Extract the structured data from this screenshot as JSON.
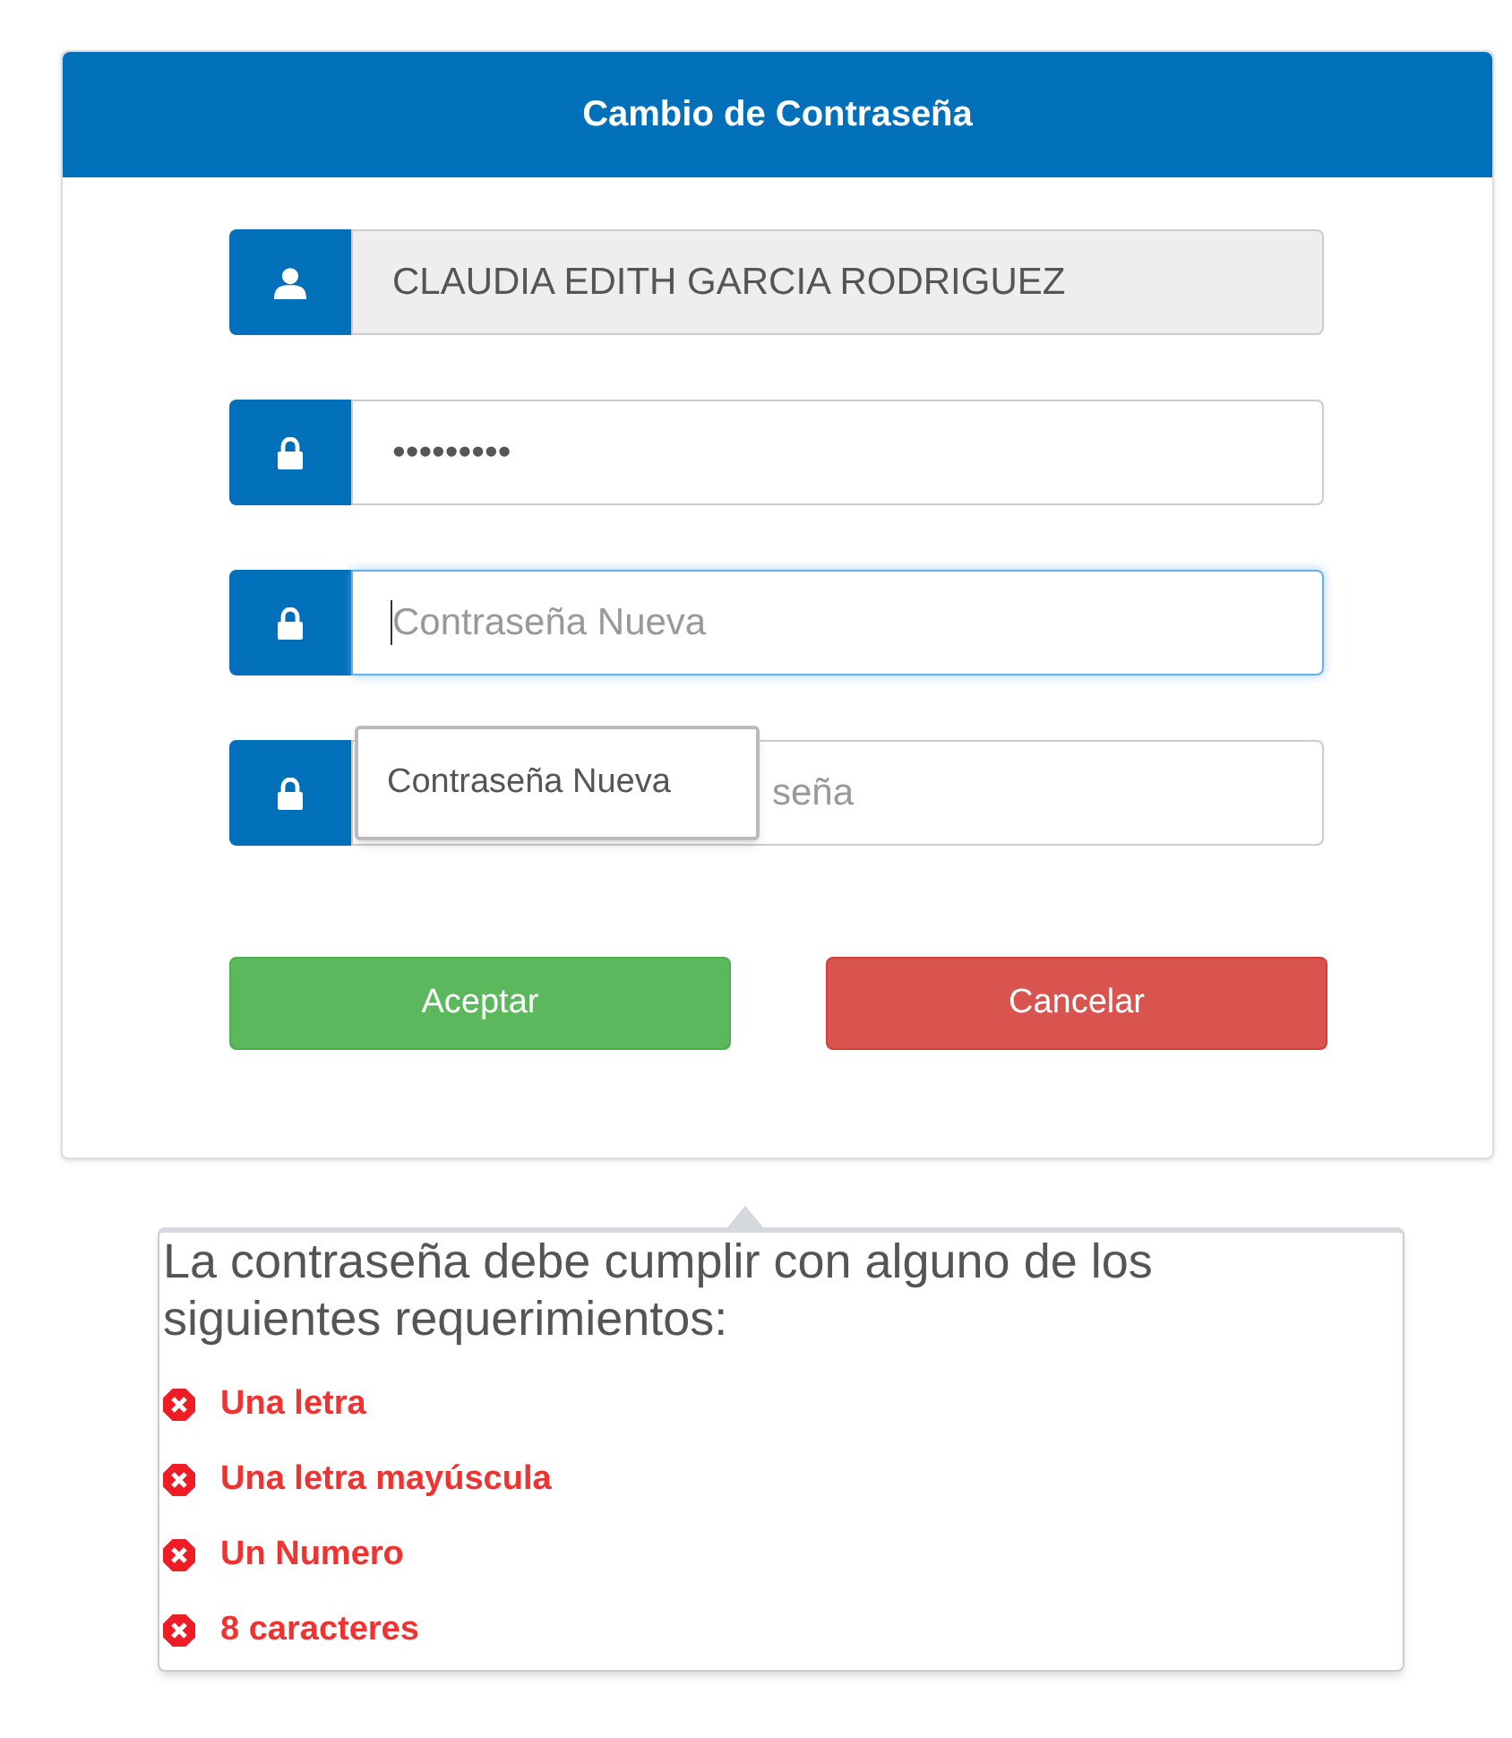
{
  "dialog": {
    "title": "Cambio de Contraseña"
  },
  "fields": [
    {
      "kind": "user",
      "value": "CLAUDIA EDITH GARCIA RODRIGUEZ",
      "disabled": true,
      "focused": false
    },
    {
      "kind": "password",
      "value": "•••••••••",
      "disabled": false,
      "focused": false
    },
    {
      "kind": "password",
      "placeholder": "Contraseña Nueva",
      "disabled": false,
      "focused": true
    },
    {
      "kind": "password",
      "placeholder": "seña",
      "disabled": false,
      "focused": false,
      "suggestion": "Contraseña Nueva"
    }
  ],
  "buttons": [
    {
      "kind": "accept",
      "label": "Aceptar"
    },
    {
      "kind": "cancel",
      "label": "Cancelar"
    }
  ],
  "requirements": {
    "title": "La contraseña debe cumplir con alguno de los siguientes requerimientos:",
    "items": [
      {
        "label": "Una letra",
        "met": false
      },
      {
        "label": "Una letra mayúscula",
        "met": false
      },
      {
        "label": "Un Numero",
        "met": false
      },
      {
        "label": "8 caracteres",
        "met": false
      }
    ]
  }
}
